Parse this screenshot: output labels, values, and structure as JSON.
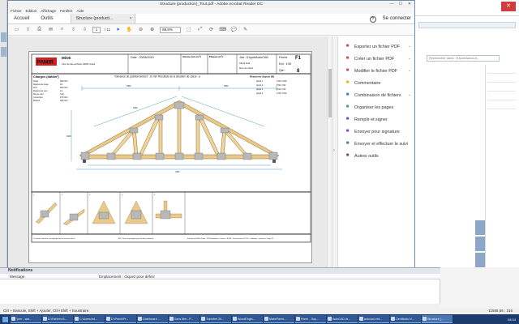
{
  "acrobat": {
    "title": "Structure (production)_Tout.pdf - Adobe Acrobat Reader DC",
    "menu": [
      "Fichier",
      "Edition",
      "Affichage",
      "Fenêtre",
      "Aide"
    ],
    "tabs": {
      "home": "Accueil",
      "tools": "Outils",
      "document": "Structure (producti...",
      "close": "×"
    },
    "signin": "Se connecter",
    "help": "?",
    "toolbar": {
      "page_current": "1",
      "page_total": "/ 11",
      "zoom": "88,8%"
    }
  },
  "drawing": {
    "company": "Mitek",
    "company_addr": "Clos rue des archivés 44000 Créteil",
    "logo_text": "PAMIR",
    "date_label": "Date : 20/06/2019",
    "volume_label": "Volume (lots (m³)",
    "plaques_label": "Plaques (m²)",
    "job": "Job : ExportAutoCAD",
    "client": "Client final",
    "site": "Nom de client",
    "ferme": "Ferme",
    "ferme_id": "F1",
    "ech": "Ech : 1:50",
    "qte_label": "Qté :",
    "qte": "8",
    "charges": "Charges (daN/m²)",
    "tolerance": "Tolérance de positionnement : 10 mm Résultats de la situation de calcul : a",
    "reactions": "Réactions Appuis (N)",
    "charges_lines": [
      "Neige",
      "Régions de neige",
      "Vent",
      "Régions de vent",
      "Site de vent",
      "Couverture",
      "Plafond"
    ],
    "charges_values": [
      "350 N/m²",
      "A2",
      "450 N/m²",
      "1A",
      "rural",
      "470 N/m²",
      "290 N/m²"
    ],
    "reaction_rows": [
      "Appui 1",
      "Appui 2",
      "Appui 3",
      "Appui 4"
    ],
    "reaction_vals": [
      "1725 / 1032",
      "8742 / 152",
      "8742 / 152",
      "1725 / 1032"
    ],
    "footer_left": "Ce dessin doit être accompagné de la note de calcul",
    "footer_mid": "M-L Toute loi protégée par les droits d'auteur",
    "footer_right": "Exécuté par MiTek Pamir - DS Pamirfermes - Licence: 10296 - Pamir version 11.2.2.6 - Utilisateur : ermenant - Page 1/1",
    "dims": {
      "top_left": "4390",
      "top_right": "4390",
      "rafter": "3350",
      "bottom": "7400",
      "height": "1940"
    },
    "detail_labels": [
      "1",
      "2",
      "3",
      "4",
      "5",
      "6",
      "7",
      "8",
      "9"
    ]
  },
  "tools_pane": {
    "items": [
      {
        "label": "Exporter un fichier PDF",
        "icon": "export-pdf-icon",
        "color": "#d93f3f"
      },
      {
        "label": "Créer un fichier PDF",
        "icon": "create-pdf-icon",
        "color": "#d93f3f"
      },
      {
        "label": "Modifier le fichier PDF",
        "icon": "edit-pdf-icon",
        "color": "#d93f3f"
      },
      {
        "label": "Commentaire",
        "icon": "comment-icon",
        "color": "#e6b400"
      },
      {
        "label": "Combinaison de fichiers",
        "icon": "combine-files-icon",
        "color": "#3a71c9"
      },
      {
        "label": "Organiser les pages",
        "icon": "organize-pages-icon",
        "color": "#3aa05a"
      },
      {
        "label": "Remplir et signer",
        "icon": "fill-sign-icon",
        "color": "#6f42c1"
      },
      {
        "label": "Envoyer pour signature",
        "icon": "send-signature-icon",
        "color": "#6f42c1"
      },
      {
        "label": "Envoyer et effectuer le suivi",
        "icon": "send-track-icon",
        "color": "#3a71c9"
      },
      {
        "label": "Autres outils",
        "icon": "more-tools-icon",
        "color": "#555555"
      }
    ]
  },
  "background": {
    "search_placeholder": "Rechercher dans : ExportAutoCA..."
  },
  "notifications": {
    "title": "Notifications",
    "col_message": "Message",
    "col_info": "Emplacement : cliquez pour définir"
  },
  "statusbar": {
    "hint": "Ctrl + Bascule, Shift + Ajouter, Ctrl+Shift + Soustraire.",
    "coords": "-11585,56 ; 316"
  },
  "taskbar": {
    "items": [
      "\"pmr - war...",
      "D:\\Fichiers B...",
      "C:\\Users\\ed...",
      "D:\\Pamir\\Pr...",
      "Dashboard ...",
      "Sans titre - P...",
      "Transfert 20...",
      "WoodEngin...",
      "MakePamir...",
      "Pamir - Sup...",
      "AutoCAD dr...",
      "autocad exil...",
      "Certificats N...",
      "Structure (..."
    ],
    "clock": "08:34"
  }
}
